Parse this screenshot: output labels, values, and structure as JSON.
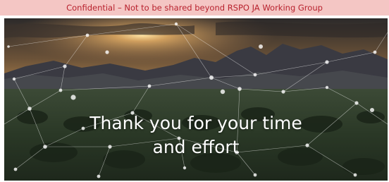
{
  "banner": {
    "text": "Confidential – Not to be shared beyond RSPO JA Working Group",
    "background_color": "#f4c6c4",
    "text_color": "#b8222e"
  },
  "closing": {
    "line1": "Thank you for your time",
    "line2": "and effort"
  },
  "photo": {
    "subject": "sunset over mountains and plantation with network overlay"
  }
}
